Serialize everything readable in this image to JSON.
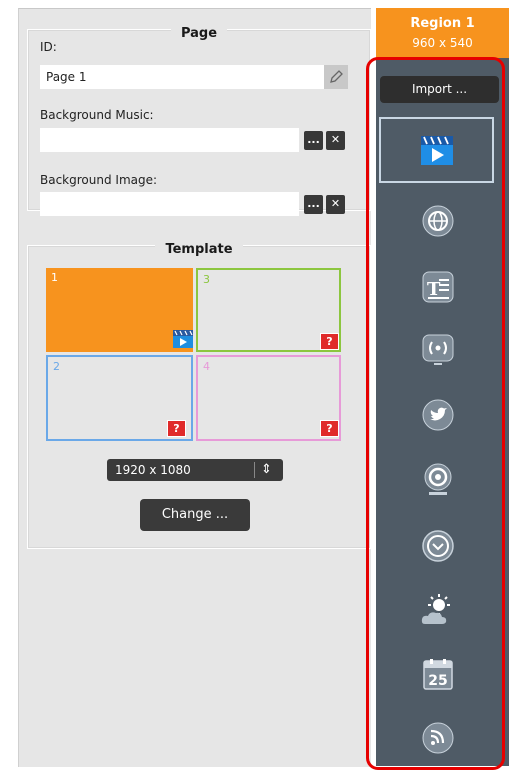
{
  "page": {
    "title": "Page",
    "id_label": "ID:",
    "id_value": "Page 1",
    "bg_music_label": "Background Music:",
    "bg_image_label": "Background Image:",
    "browse": "...",
    "clear": "✕"
  },
  "template": {
    "title": "Template",
    "cells": [
      {
        "num": "1"
      },
      {
        "num": "3"
      },
      {
        "num": "2"
      },
      {
        "num": "4"
      }
    ],
    "unknown": "?",
    "resolution": "1920 x 1080",
    "resolution_arrows": "⇕",
    "change_label": "Change ..."
  },
  "region": {
    "title": "Region 1",
    "size": "960 x 540",
    "import_label": "Import ..."
  },
  "tools": [
    "video-icon",
    "web-icon",
    "text-icon",
    "broadcast-icon",
    "twitter-icon",
    "camera-icon",
    "clock-icon",
    "weather-icon",
    "calendar-icon",
    "rss-icon"
  ],
  "calendar_day": "25",
  "colors": {
    "accent": "#f7931e",
    "toolbar": "#4f5b66",
    "highlight": "#e60000",
    "tpl_green": "#8cc63f",
    "tpl_blue": "#6aa8e8",
    "tpl_pink": "#e79ad8"
  }
}
